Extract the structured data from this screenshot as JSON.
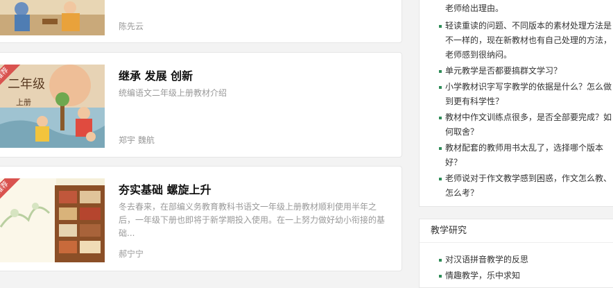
{
  "articles": [
    {
      "title": "",
      "description": "",
      "author": "陈先云",
      "badge": ""
    },
    {
      "title": "继承 发展 创新",
      "description": "统编语文二年级上册教材介绍",
      "author": "郑宇 魏航",
      "badge": "推荐",
      "cover_text": {
        "grade": "二年级",
        "volume": "上册"
      }
    },
    {
      "title": "夯实基础 螺旋上升",
      "description": "冬去春来，在部编义务教育教科书语文一年级上册教材顺利使用半年之后，一年级下册也即将于新学期投入使用。在一上努力做好幼小衔接的基础...",
      "author": "郝宁宁",
      "badge": "推荐"
    }
  ],
  "sidebar": {
    "faq_items": [
      "老师给出理由。",
      "轻读重读的问题、不同版本的素材处理方法是不一样的，现在新教材也有自己处理的方法，老师感到很纳闷。",
      "单元教学是否都要搞群文学习？",
      "小学教材识字写字教学的依据是什么？怎么做到更有科学性？",
      "教材中作文训练点很多，是否全部要完成？如何取舍？",
      "教材配套的教师用书太乱了，选择哪个版本好？",
      "老师说对于作文教学感到困惑，作文怎么教、怎么考？"
    ],
    "research": {
      "heading": "教学研究",
      "items": [
        "对汉语拼音教学的反思",
        "情趣教学，乐中求知"
      ]
    }
  },
  "colors": {
    "accent_green": "#2e8b57",
    "badge_red": "#d9534f"
  }
}
